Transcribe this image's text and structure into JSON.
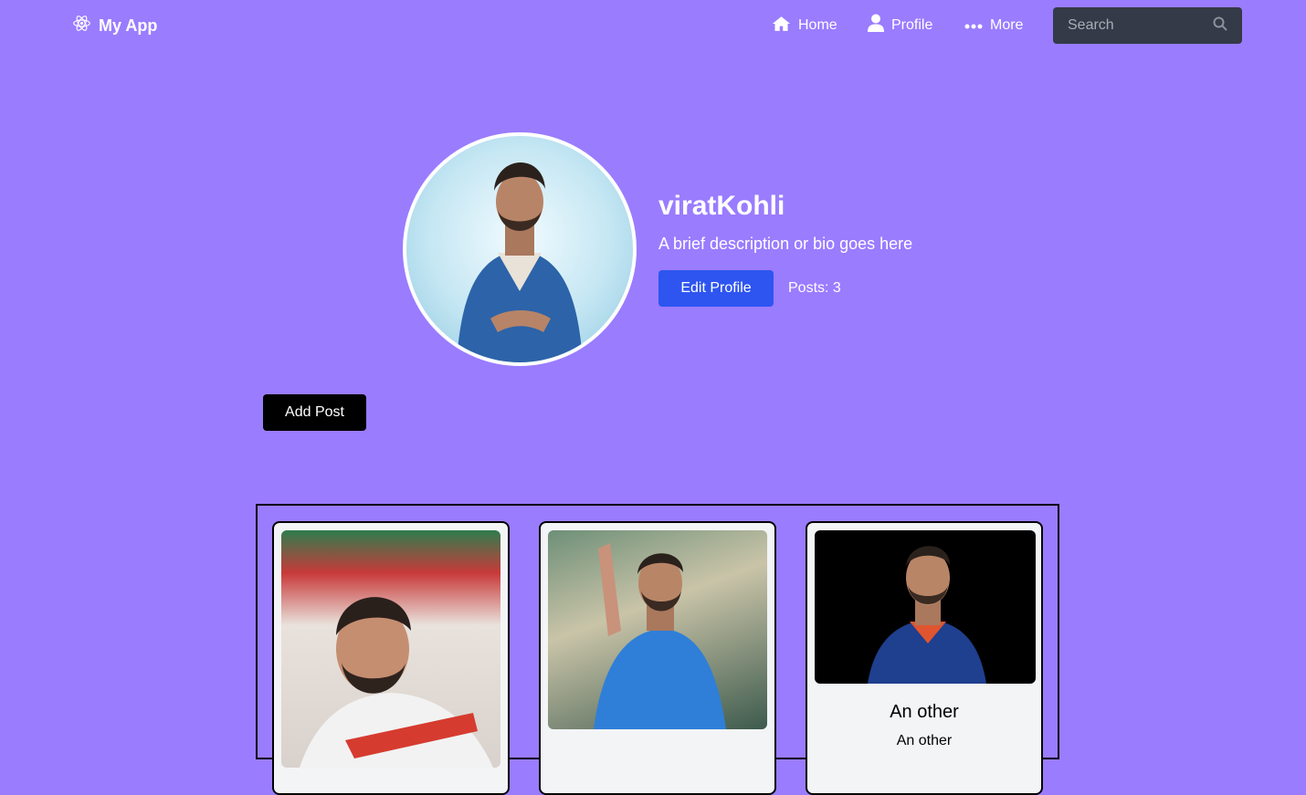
{
  "navbar": {
    "brand": "My App",
    "brand_icon": "react-atom-icon",
    "links": [
      {
        "label": "Home",
        "icon": "home-icon"
      },
      {
        "label": "Profile",
        "icon": "user-icon"
      },
      {
        "label": "More",
        "icon": "ellipsis-icon"
      }
    ],
    "search_placeholder": "Search",
    "search_icon": "search-icon"
  },
  "profile": {
    "username": "viratKohli",
    "bio": "A brief description or bio goes here",
    "edit_label": "Edit Profile",
    "posts_label": "Posts: 3"
  },
  "add_post_label": "Add Post",
  "posts": [
    {
      "title": "",
      "text": ""
    },
    {
      "title": "",
      "text": ""
    },
    {
      "title": "An other",
      "text": "An other"
    }
  ],
  "colors": {
    "background": "#9a7cff",
    "search_bg": "#343a47",
    "edit_button": "#2e55f0",
    "add_post_button": "#000000",
    "card_bg": "#f3f4f6"
  }
}
